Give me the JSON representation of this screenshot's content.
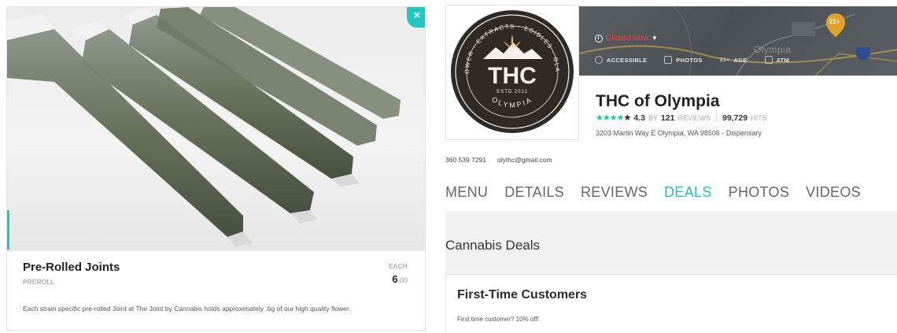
{
  "product": {
    "name": "Pre-Rolled Joints",
    "type": "PREROLL",
    "price_label": "EACH",
    "price_int": "6",
    "price_dec": ".00",
    "description": "Each strain specific pre-rolled Joint at The Joint by Cannabis holds approximately .6g of our high quality flower.",
    "close_icon": "close-icon"
  },
  "dispensary": {
    "logo": {
      "arc_text": "FLOWER · EXTRACTS · EDIBLES · GLASS",
      "main": "THC",
      "est": "ESTD 2011",
      "bottom": "OLYMPIA"
    },
    "status": "Closed Now",
    "amenities": [
      {
        "label": "ACCESSIBLE",
        "icon": "wheelchair-icon"
      },
      {
        "label": "PHOTOS",
        "icon": "camera-icon"
      },
      {
        "label": "AGE",
        "badge": "21+",
        "icon": "age-icon"
      },
      {
        "label": "ATM",
        "icon": "atm-icon"
      }
    ],
    "map": {
      "city": "Olympia",
      "pin": "21+"
    },
    "name": "THC of Olympia",
    "rating": "4.3",
    "rating_by": "BY",
    "reviews_count": "121",
    "reviews_label": "REVIEWS",
    "hits_count": "99,729",
    "hits_label": "HITS",
    "address": "3203 Martin Way E Olympia, WA 98506 - Dispensary",
    "phone": "360 539 7291",
    "email": "olythc@gmail.com",
    "tabs": [
      "MENU",
      "DETAILS",
      "REVIEWS",
      "DEALS",
      "PHOTOS",
      "VIDEOS"
    ],
    "active_tab": "DEALS",
    "deals_heading": "Cannabis Deals",
    "deal": {
      "title": "First-Time Customers",
      "description": "First time customer? 10% off!"
    }
  },
  "colors": {
    "accent": "#20c1b8",
    "closed": "#ff3d3d"
  }
}
